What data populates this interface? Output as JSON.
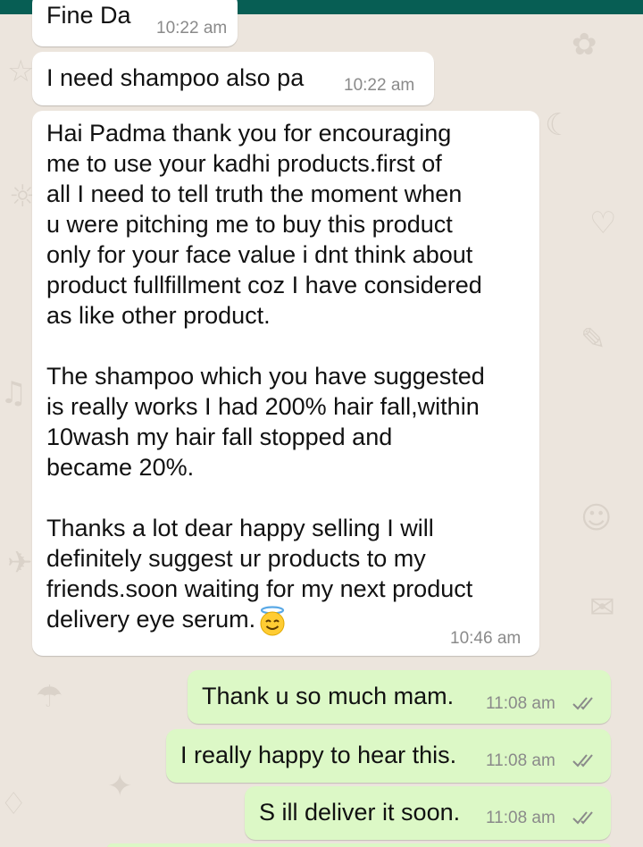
{
  "colors": {
    "background": "#ECE5DD",
    "header": "#075E54",
    "incoming_bubble": "#FFFFFF",
    "outgoing_bubble": "#DCF8C6",
    "timestamp": "#8a8a8a",
    "read_ticks": "#8a8a8a"
  },
  "messages": [
    {
      "direction": "incoming",
      "text": "Fine Da",
      "time": "10:22 am"
    },
    {
      "direction": "incoming",
      "text": "I need shampoo also pa",
      "time": "10:22 am"
    },
    {
      "direction": "incoming",
      "text": "Hai Padma thank you for encouraging\nme to use your kadhi products.first of\nall I need to tell truth the moment when\nu were pitching me to buy this product\nonly for your face value i dnt think about\nproduct fullfillment coz I have considered\nas like other product.\n\nThe shampoo which you have suggested\nis really works I had 200% hair fall,within\n10wash my hair fall stopped and\nbecame 20%.\n\nThanks a lot dear happy selling I will\ndefinitely suggest ur products to my\nfriends.soon waiting for my next product\ndelivery eye serum.",
      "emoji": "smiling-face-with-halo",
      "time": "10:46 am"
    },
    {
      "direction": "outgoing",
      "text": "Thank u so much mam.",
      "time": "11:08 am",
      "status": "read-double-check"
    },
    {
      "direction": "outgoing",
      "text": "I really happy to hear this.",
      "time": "11:08 am",
      "status": "read-double-check"
    },
    {
      "direction": "outgoing",
      "text": "S ill deliver it soon.",
      "time": "11:08 am",
      "status": "read-double-check"
    }
  ]
}
